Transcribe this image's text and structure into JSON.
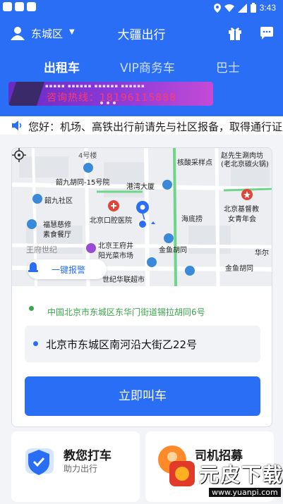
{
  "status_bar": {
    "time": "3:43"
  },
  "header": {
    "city": "东城区",
    "title": "大疆出行",
    "tabs": [
      {
        "label": "出租车",
        "active": true
      },
      {
        "label": "VIP商务车",
        "active": false
      },
      {
        "label": "巴士",
        "active": false
      }
    ],
    "icons": [
      "gift-icon",
      "message-icon"
    ]
  },
  "banner": {
    "phone": "咨询热线：18196115888"
  },
  "notice": {
    "text": "您好：机场、高铁出行前请先与社区报备，取得通行证后"
  },
  "map": {
    "labels": [
      "4号楼",
      "核酸采样点",
      "赵先生涮肉坊",
      "(老北京碳火锅)",
      "韶九胡同-15号院",
      "港湾大厦",
      "韶九社区",
      "北京基督教",
      "女青年会",
      "北京口腔医院",
      "海底捞",
      "福慧慈修",
      "素食餐厅",
      "北京王府井",
      "阳光菜市场",
      "金鱼胡同",
      "华尔",
      "王府世纪",
      "金鱼胡同",
      "世纪华联超市"
    ],
    "alarm_label": "一键报警"
  },
  "trip": {
    "from": "中国北京市东城区东华门街道锡拉胡同6号",
    "to": "北京市东城区南河沿大街乙22号",
    "call_button": "立即叫车"
  },
  "bottom": {
    "left": {
      "title": "教您打车",
      "subtitle": "助力出行"
    },
    "right": {
      "title": "司机招募"
    }
  },
  "watermark": {
    "brand": "元皮下载",
    "url": "www.yuanpi.com"
  },
  "colors": {
    "primary": "#2a6ef5",
    "from_green": "#3aa64a",
    "pin_red": "#e0453a"
  }
}
